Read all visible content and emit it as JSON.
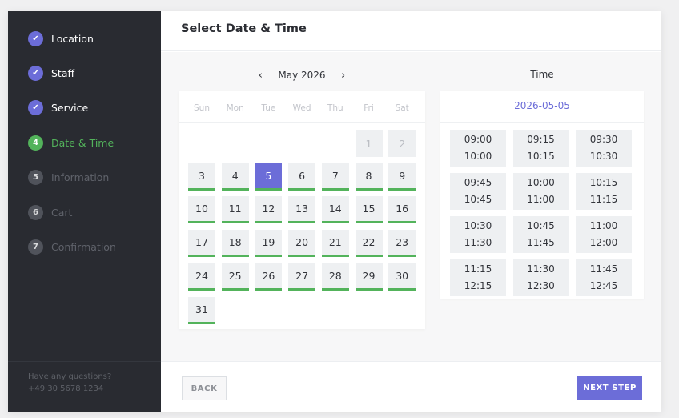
{
  "sidebar": {
    "steps": [
      {
        "number": "1",
        "label": "Location",
        "status": "done"
      },
      {
        "number": "2",
        "label": "Staff",
        "status": "done"
      },
      {
        "number": "3",
        "label": "Service",
        "status": "done"
      },
      {
        "number": "4",
        "label": "Date & Time",
        "status": "active"
      },
      {
        "number": "5",
        "label": "Information",
        "status": "todo"
      },
      {
        "number": "6",
        "label": "Cart",
        "status": "todo"
      },
      {
        "number": "7",
        "label": "Confirmation",
        "status": "todo"
      }
    ],
    "check_glyph": "✔",
    "support_title": "Have any questions?",
    "support_phone": "+49 30 5678 1234"
  },
  "header": {
    "title": "Select Date & Time"
  },
  "calendar": {
    "month_label": "May 2026",
    "prev_glyph": "‹",
    "next_glyph": "›",
    "weekdays": [
      "Sun",
      "Mon",
      "Tue",
      "Wed",
      "Thu",
      "Fri",
      "Sat"
    ],
    "days": [
      {
        "label": "1",
        "state": "disabled"
      },
      {
        "label": "2",
        "state": "disabled"
      },
      {
        "label": "3",
        "state": "available"
      },
      {
        "label": "4",
        "state": "available"
      },
      {
        "label": "5",
        "state": "selected"
      },
      {
        "label": "6",
        "state": "available"
      },
      {
        "label": "7",
        "state": "available"
      },
      {
        "label": "8",
        "state": "available"
      },
      {
        "label": "9",
        "state": "available"
      },
      {
        "label": "10",
        "state": "available"
      },
      {
        "label": "11",
        "state": "available"
      },
      {
        "label": "12",
        "state": "available"
      },
      {
        "label": "13",
        "state": "available"
      },
      {
        "label": "14",
        "state": "available"
      },
      {
        "label": "15",
        "state": "available"
      },
      {
        "label": "16",
        "state": "available"
      },
      {
        "label": "17",
        "state": "available"
      },
      {
        "label": "18",
        "state": "available"
      },
      {
        "label": "19",
        "state": "available"
      },
      {
        "label": "20",
        "state": "available"
      },
      {
        "label": "21",
        "state": "available"
      },
      {
        "label": "22",
        "state": "available"
      },
      {
        "label": "23",
        "state": "available"
      },
      {
        "label": "24",
        "state": "available"
      },
      {
        "label": "25",
        "state": "available"
      },
      {
        "label": "26",
        "state": "available"
      },
      {
        "label": "27",
        "state": "available"
      },
      {
        "label": "28",
        "state": "available"
      },
      {
        "label": "29",
        "state": "available"
      },
      {
        "label": "30",
        "state": "available"
      },
      {
        "label": "31",
        "state": "available"
      }
    ]
  },
  "time": {
    "title": "Time",
    "selected_date": "2026-05-05",
    "slots": [
      {
        "start": "09:00",
        "end": "10:00"
      },
      {
        "start": "09:15",
        "end": "10:15"
      },
      {
        "start": "09:30",
        "end": "10:30"
      },
      {
        "start": "09:45",
        "end": "10:45"
      },
      {
        "start": "10:00",
        "end": "11:00"
      },
      {
        "start": "10:15",
        "end": "11:15"
      },
      {
        "start": "10:30",
        "end": "11:30"
      },
      {
        "start": "10:45",
        "end": "11:45"
      },
      {
        "start": "11:00",
        "end": "12:00"
      },
      {
        "start": "11:15",
        "end": "12:15"
      },
      {
        "start": "11:30",
        "end": "12:30"
      },
      {
        "start": "11:45",
        "end": "12:45"
      }
    ]
  },
  "footer": {
    "back_label": "BACK",
    "next_label": "NEXT STEP"
  },
  "colors": {
    "accent": "#6c6dd8",
    "available": "#53b35b",
    "sidebar_bg": "#292b31"
  }
}
